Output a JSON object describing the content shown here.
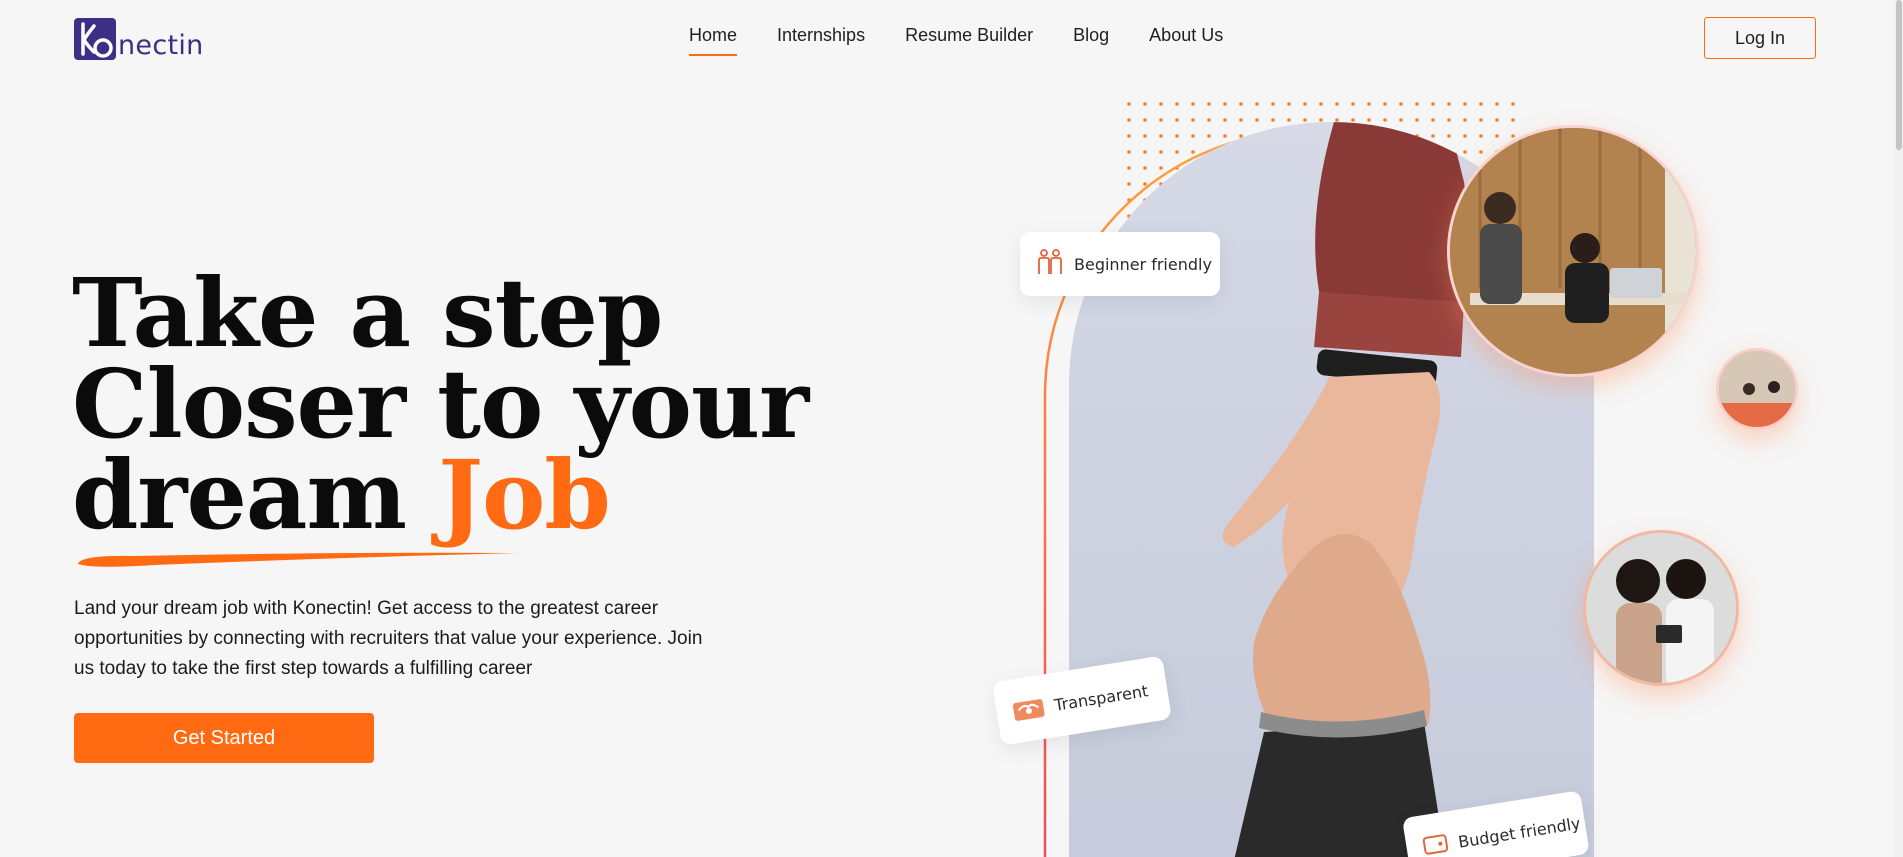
{
  "brand": {
    "name": "nectin",
    "mark": "Ko"
  },
  "nav": {
    "items": [
      {
        "label": "Home"
      },
      {
        "label": "Internships"
      },
      {
        "label": "Resume Builder"
      },
      {
        "label": "Blog"
      },
      {
        "label": "About Us"
      }
    ],
    "active": "Home"
  },
  "header": {
    "login_label": "Log In"
  },
  "hero": {
    "headline_line1": "Take a step",
    "headline_line2": "Closer to your",
    "headline_line3_plain": "dream ",
    "headline_line3_accent": "Job",
    "subtext": "Land your dream job with Konectin! Get access to the greatest career opportunities by connecting with recruiters that value your experience. Join us today to take the first step towards a fulfilling career",
    "cta_label": "Get Started"
  },
  "badges": {
    "beginner": {
      "label": "Beginner friendly",
      "icon": "people-icon"
    },
    "transparent": {
      "label": "Transparent",
      "icon": "handshake-icon"
    },
    "budget": {
      "label": "Budget friendly",
      "icon": "wallet-icon"
    }
  },
  "colors": {
    "accent": "#ff6a13",
    "brand": "#3d2f85",
    "background": "#f6f6f6"
  }
}
